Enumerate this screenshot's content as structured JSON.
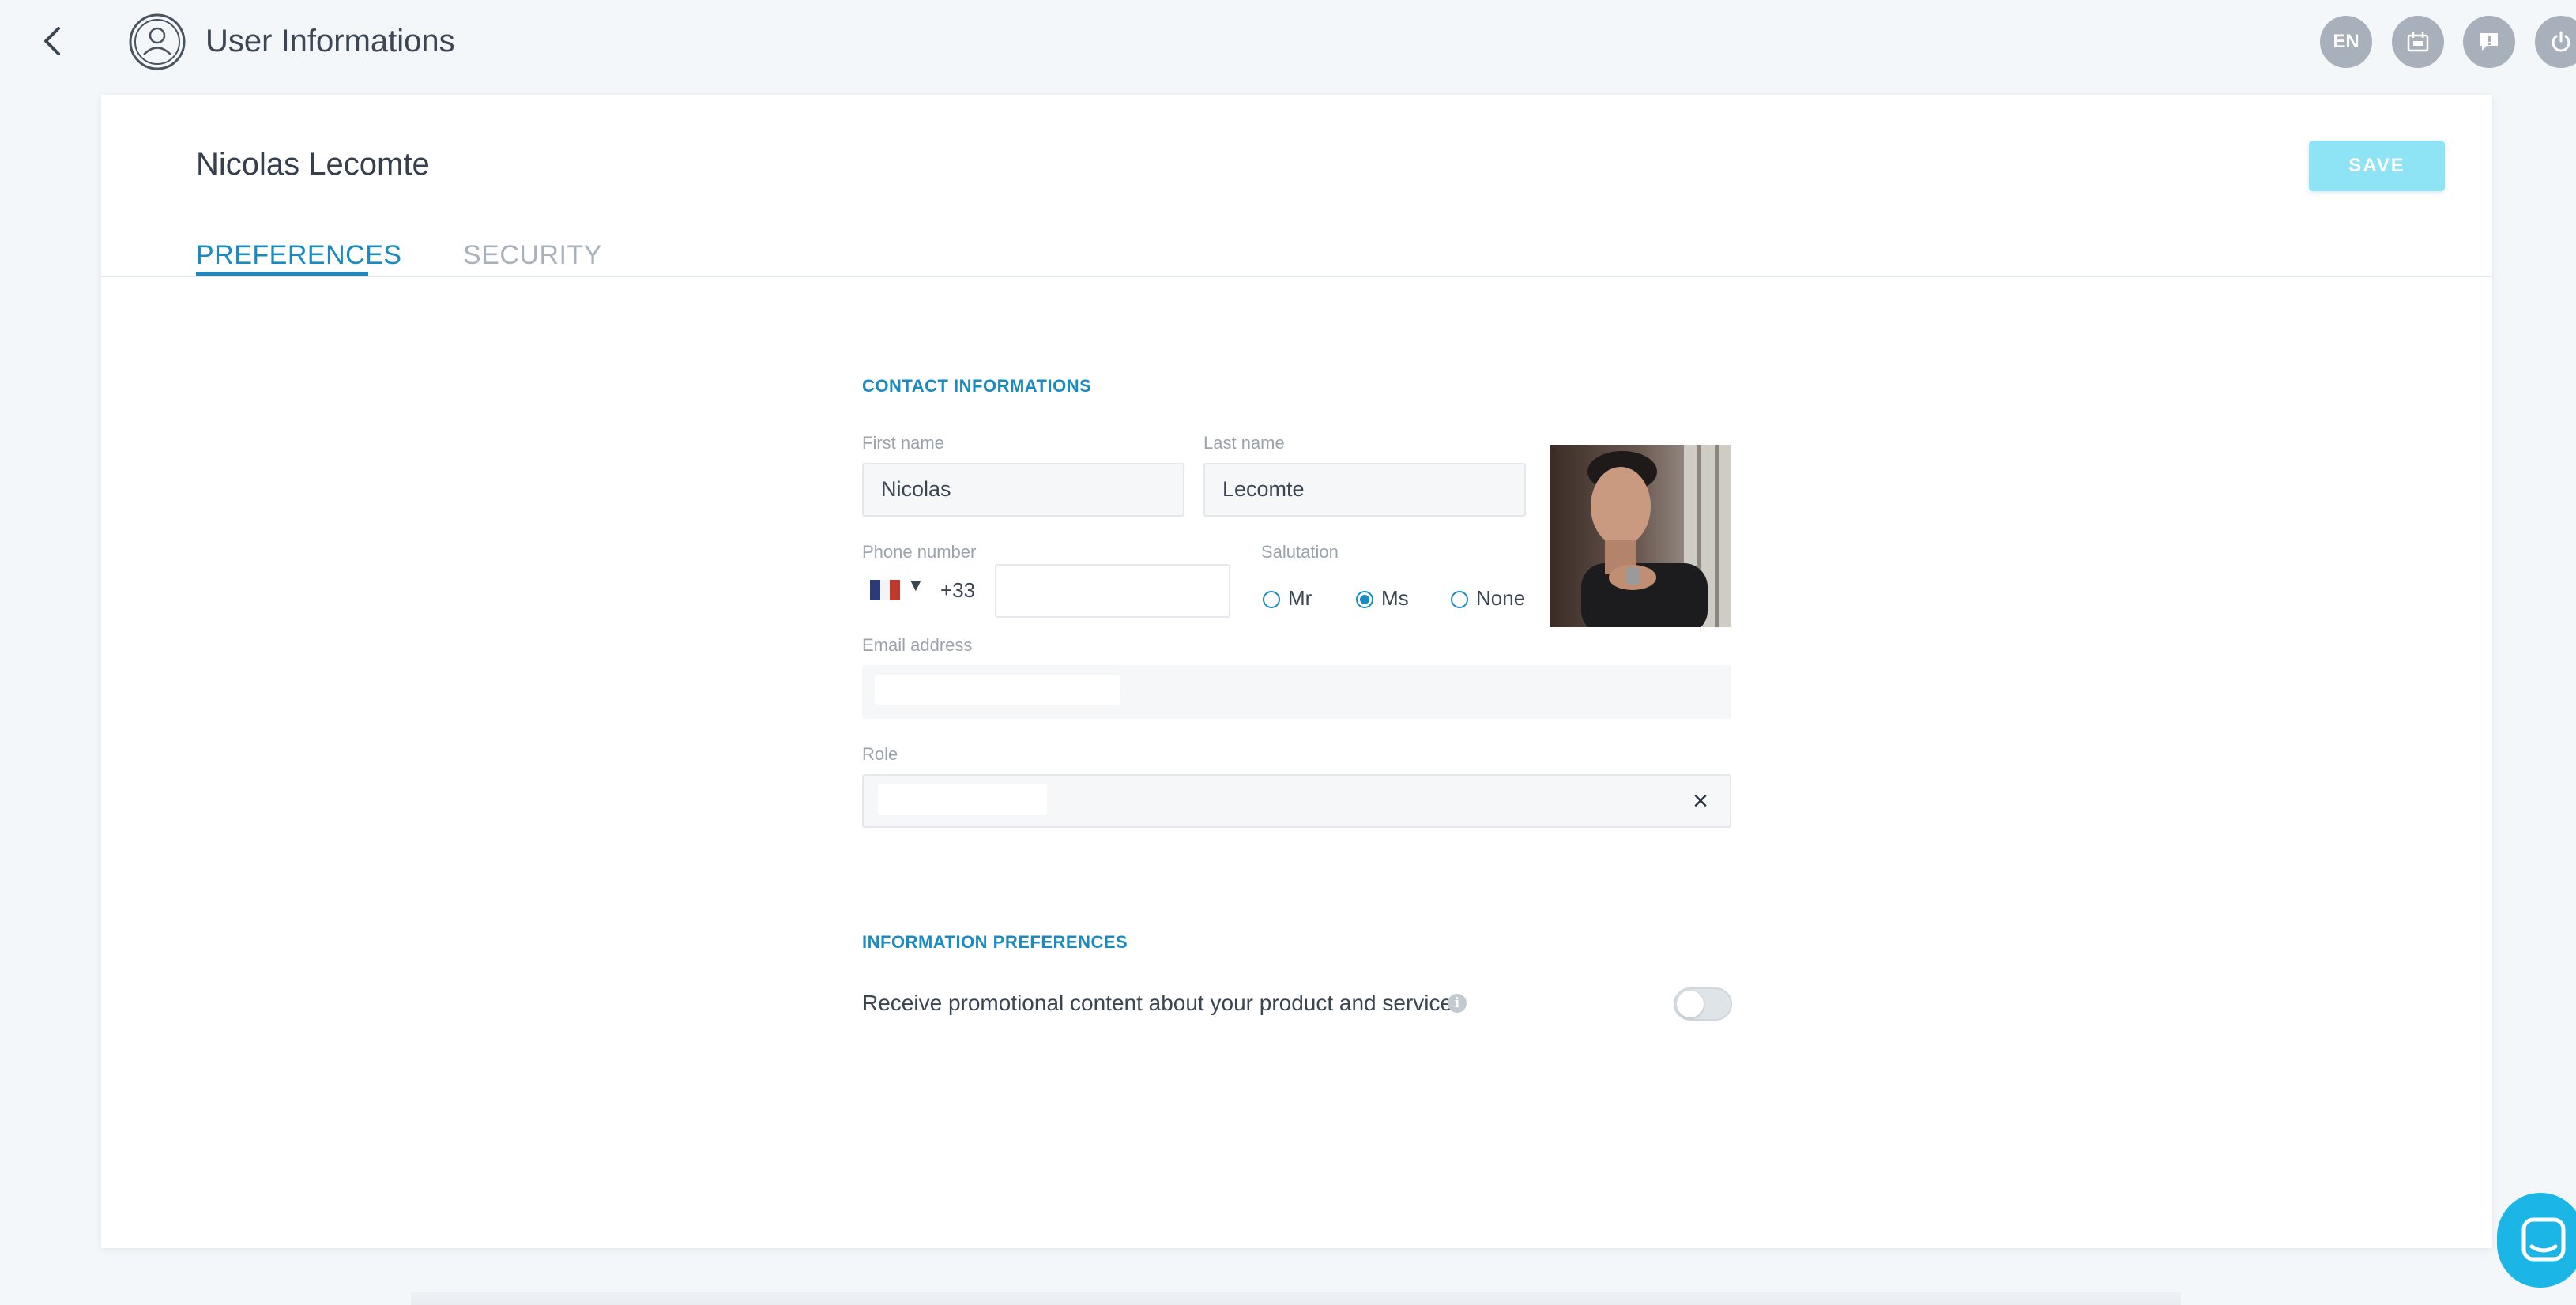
{
  "header": {
    "title": "User Informations",
    "lang_label": "EN"
  },
  "user": {
    "display_name": "Nicolas Lecomte"
  },
  "actions": {
    "save_label": "SAVE"
  },
  "tabs": [
    {
      "label": "PREFERENCES",
      "active": true
    },
    {
      "label": "SECURITY",
      "active": false
    }
  ],
  "contact": {
    "section_title": "CONTACT INFORMATIONS",
    "first_name": {
      "label": "First name",
      "value": "Nicolas"
    },
    "last_name": {
      "label": "Last name",
      "value": "Lecomte"
    },
    "phone": {
      "label": "Phone number",
      "prefix": "+33",
      "value": ""
    },
    "salutation": {
      "label": "Salutation",
      "options": [
        "Mr",
        "Ms",
        "None"
      ],
      "selected": "Ms"
    },
    "email": {
      "label": "Email address",
      "value": ""
    },
    "role": {
      "label": "Role",
      "value": "",
      "clear_icon": "×"
    }
  },
  "info_preferences": {
    "section_title": "INFORMATION PREFERENCES",
    "promo_label": "Receive promotional content about your product and services",
    "info_icon": "i",
    "promo_enabled": false
  },
  "colors": {
    "accent": "#1a8bc2",
    "save_button": "#8ee3f5",
    "chat_button": "#1bb5e6",
    "top_circle": "#a7b0bb"
  },
  "icons": {
    "back": "chevron-left-icon",
    "avatar": "user-avatar-icon",
    "calendar": "calendar-icon",
    "feedback": "feedback-icon",
    "power": "power-icon",
    "chat": "chat-icon",
    "flag": "france-flag-icon"
  }
}
